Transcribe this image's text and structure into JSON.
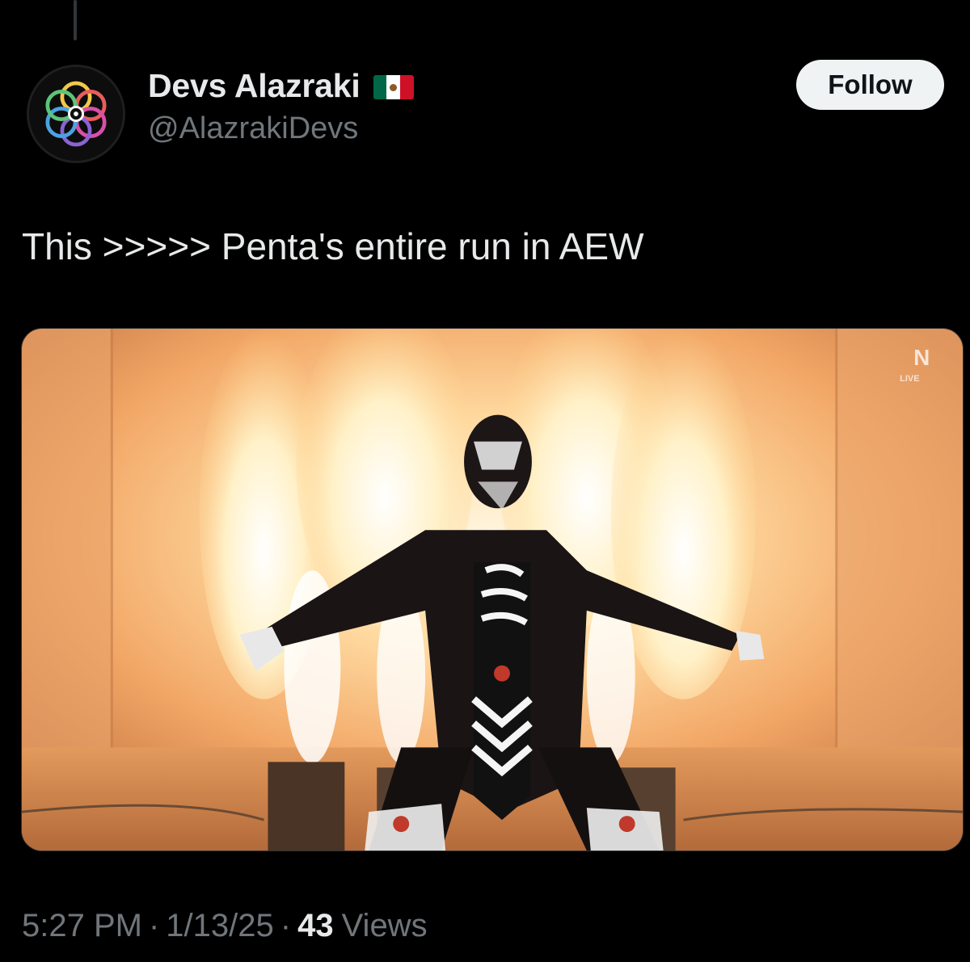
{
  "tweet": {
    "author": {
      "display_name": "Devs Alazraki",
      "flag_icon": "mexico-flag-icon",
      "handle": "@AlazrakiDevs"
    },
    "follow_label": "Follow",
    "text": "This >>>>> Penta's entire run in AEW",
    "media": {
      "corner_logo_text": "LIVE"
    },
    "meta": {
      "time": "5:27 PM",
      "separator": "·",
      "date": "1/13/25",
      "views_count": "43",
      "views_label": "Views"
    }
  },
  "colors": {
    "background": "#000000",
    "primary_text": "#e7e9ea",
    "secondary_text": "#71767b",
    "follow_button_bg": "#eff3f4"
  }
}
